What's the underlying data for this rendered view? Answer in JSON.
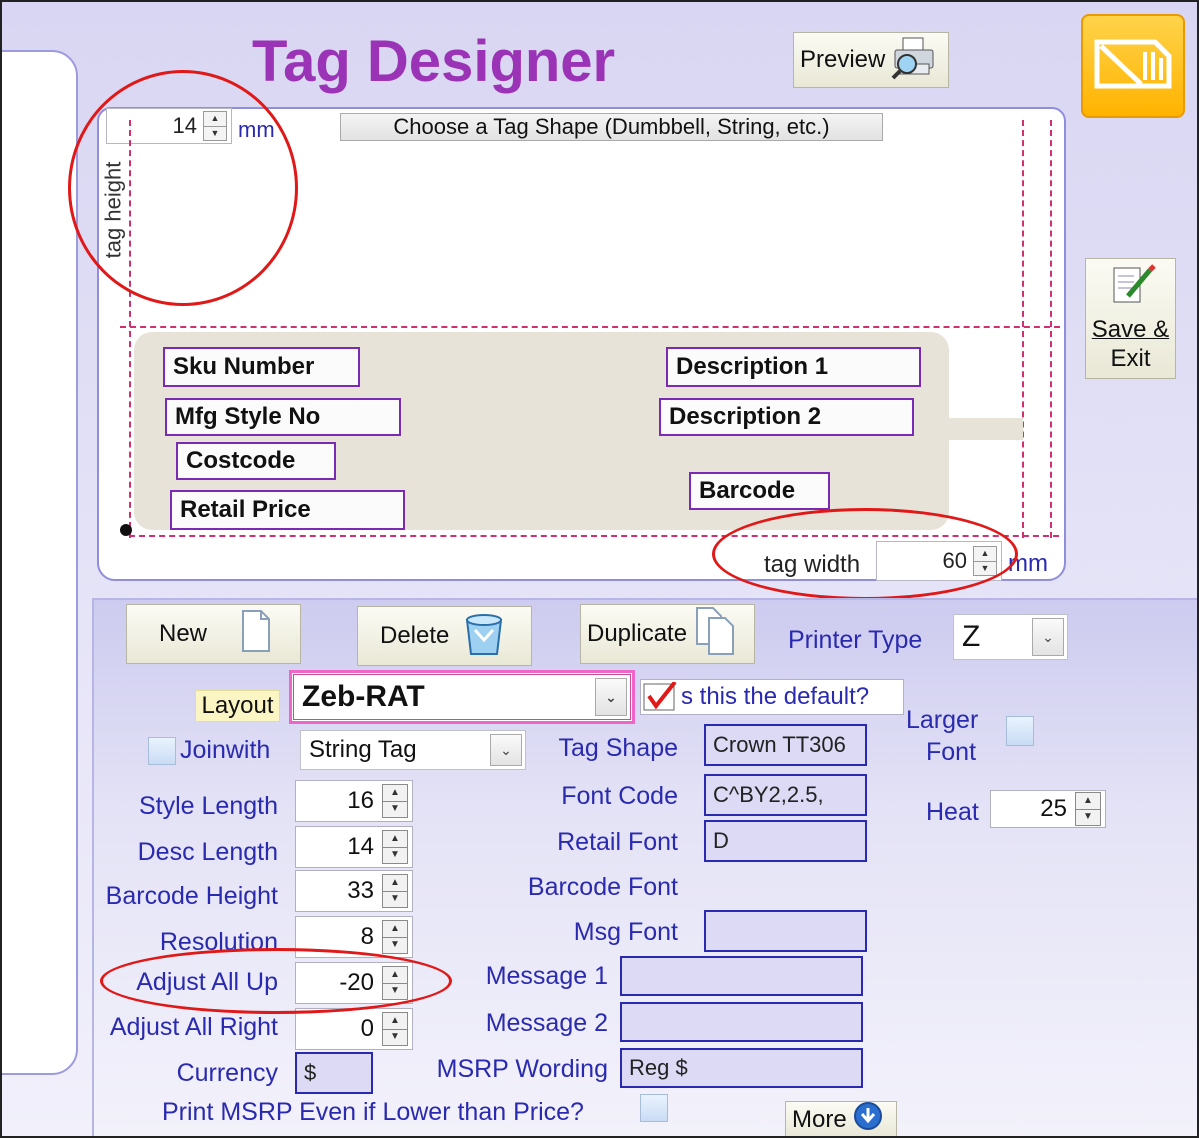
{
  "header": {
    "title": "Tag Designer",
    "preview_label": "Preview"
  },
  "designer": {
    "tag_height_value": "14",
    "height_unit": "mm",
    "tag_height_label": "tag height",
    "shape_button_label": "Choose a Tag Shape (Dumbbell, String, etc.)",
    "tag_width_label": "tag width",
    "tag_width_value": "60",
    "width_unit": "mm",
    "fields": {
      "sku": "Sku Number",
      "mfg": "Mfg Style No",
      "costcode": "Costcode",
      "retail": "Retail Price",
      "desc1": "Description 1",
      "desc2": "Description 2",
      "barcode": "Barcode"
    }
  },
  "side": {
    "save_exit_line1": "Save &",
    "save_exit_line2": "Exit"
  },
  "toolbar": {
    "new_label": "New",
    "delete_label": "Delete",
    "duplicate_label": "Duplicate",
    "printer_type_label": "Printer Type",
    "printer_type_value": "Z"
  },
  "form": {
    "layout_label": "Layout",
    "layout_value": "Zeb-RAT",
    "default_label": "s this the default?",
    "joinwith_label": "Joinwith",
    "joinwith_value": "String Tag",
    "larger_font_line1": "Larger",
    "larger_font_line2": "Font",
    "heat_label": "Heat",
    "heat_value": "25",
    "style_length_label": "Style Length",
    "style_length_value": "16",
    "desc_length_label": "Desc Length",
    "desc_length_value": "14",
    "barcode_height_label": "Barcode Height",
    "barcode_height_value": "33",
    "resolution_label": "Resolution",
    "resolution_value": "8",
    "adjust_up_label": "Adjust All Up",
    "adjust_up_value": "-20",
    "adjust_right_label": "Adjust All Right",
    "adjust_right_value": "0",
    "currency_label": "Currency",
    "currency_value": "$",
    "tag_shape_label": "Tag Shape",
    "tag_shape_value": "Crown TT306",
    "font_code_label": "Font Code",
    "font_code_value": "C^BY2,2.5,",
    "retail_font_label": "Retail Font",
    "retail_font_value": "D",
    "barcode_font_label": "Barcode Font",
    "msg_font_label": "Msg Font",
    "msg_font_value": "",
    "message1_label": "Message 1",
    "message1_value": "",
    "message2_label": "Message 2",
    "message2_value": "",
    "msrp_wording_label": "MSRP Wording",
    "msrp_wording_value": "Reg $",
    "print_msrp_label": "Print MSRP Even if Lower than Price?",
    "more_label": "More"
  },
  "colors": {
    "title": "#9b33b6",
    "label_blue": "#2a2ab0",
    "annotation_red": "#e01818",
    "guide_pink": "#d0306f",
    "field_border": "#7a2ab3"
  }
}
